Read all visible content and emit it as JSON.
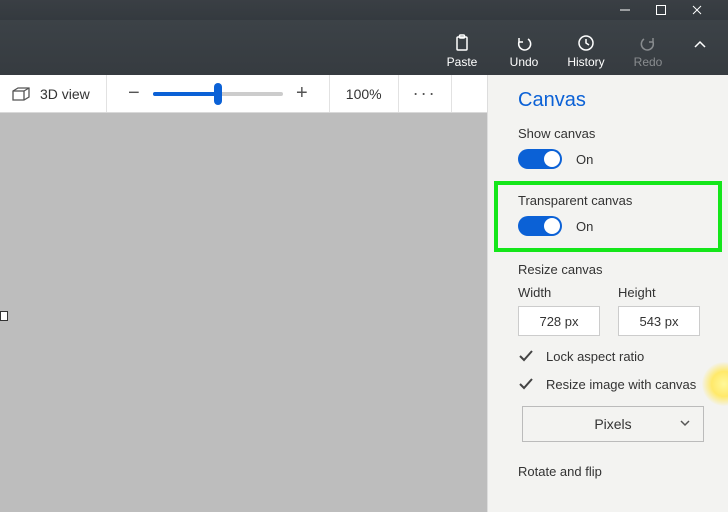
{
  "titlebar": {},
  "ribbon": {
    "paste": "Paste",
    "undo": "Undo",
    "history": "History",
    "redo": "Redo"
  },
  "toolbar": {
    "view3d": "3D view",
    "zoom_pct": "100%"
  },
  "panel": {
    "title": "Canvas",
    "show_canvas_label": "Show canvas",
    "show_canvas_state": "On",
    "transparent_label": "Transparent canvas",
    "transparent_state": "On",
    "resize_label": "Resize canvas",
    "width_label": "Width",
    "height_label": "Height",
    "width_value": "728 px",
    "height_value": "543 px",
    "lock_ratio": "Lock aspect ratio",
    "resize_with_canvas": "Resize image with canvas",
    "unit": "Pixels",
    "rotate_label": "Rotate and flip"
  }
}
